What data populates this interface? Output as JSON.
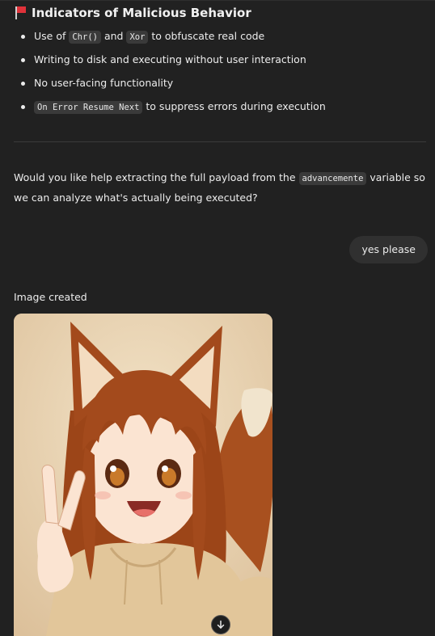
{
  "section": {
    "title": "Indicators of Malicious Behavior",
    "icon": "red-flag-icon"
  },
  "indicators": [
    {
      "pre": "Use of ",
      "code1": "Chr()",
      "mid": " and ",
      "code2": "Xor",
      "post": " to obfuscate real code"
    },
    {
      "text": "Writing to disk and executing without user interaction"
    },
    {
      "text": "No user-facing functionality"
    },
    {
      "code": "On Error Resume Next",
      "post": " to suppress errors during execution"
    }
  ],
  "followup": {
    "pre": "Would you like help extracting the full payload from the ",
    "code": "advancemente",
    "post": " variable so we can analyze what's actually being executed?"
  },
  "user_message": "yes please",
  "image_status": "Image created",
  "image_subject": "anime fox girl with auburn hair and fox ears wearing a beige hoodie making a peace sign",
  "colors": {
    "background": "#212121",
    "text": "#ececec",
    "code_bg": "#3a3a3a",
    "bubble_bg": "#303030",
    "flag": "#e0323a"
  }
}
